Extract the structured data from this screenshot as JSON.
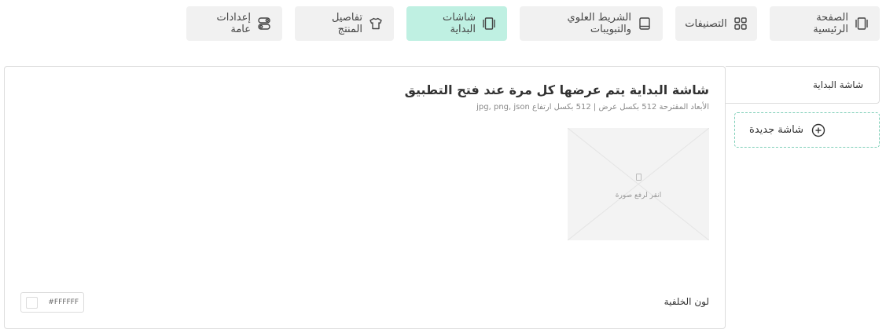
{
  "tabs": [
    {
      "label": "الصفحة الرئيسية",
      "icon": "home-screen-icon",
      "active": false
    },
    {
      "label": "التصنيفات",
      "icon": "grid-icon",
      "active": false
    },
    {
      "label": "الشريط العلوي والتبويبات",
      "icon": "tablet-icon",
      "active": false
    },
    {
      "label": "شاشات البداية",
      "icon": "screens-icon",
      "active": true
    },
    {
      "label": "تفاصيل المنتج",
      "icon": "shirt-icon",
      "active": false
    },
    {
      "label": "إعدادات عامة",
      "icon": "toggle-settings-icon",
      "active": false
    }
  ],
  "side": {
    "current_label": "شاشة البداية",
    "new_label": "شاشة جديدة",
    "new_icon": "plus-circle-icon"
  },
  "panel": {
    "title": "شاشة البداية يتم عرضها كل مرة عند فتح التطبيق",
    "subtitle": "الأبعاد المقترحة 512 بكسل عرض | 512 بكسل ارتفاع jpg, png, json",
    "upload_text": "انقر لرفع صورة",
    "upload_icon": "image-placeholder-icon",
    "bg_label": "لون الخلفية",
    "bg_color_value": "#FFFFFF"
  },
  "colors": {
    "active_tab": "#bff0e2",
    "tab_bg": "#f1f1f1",
    "accent_border": "#7fcfb8"
  }
}
